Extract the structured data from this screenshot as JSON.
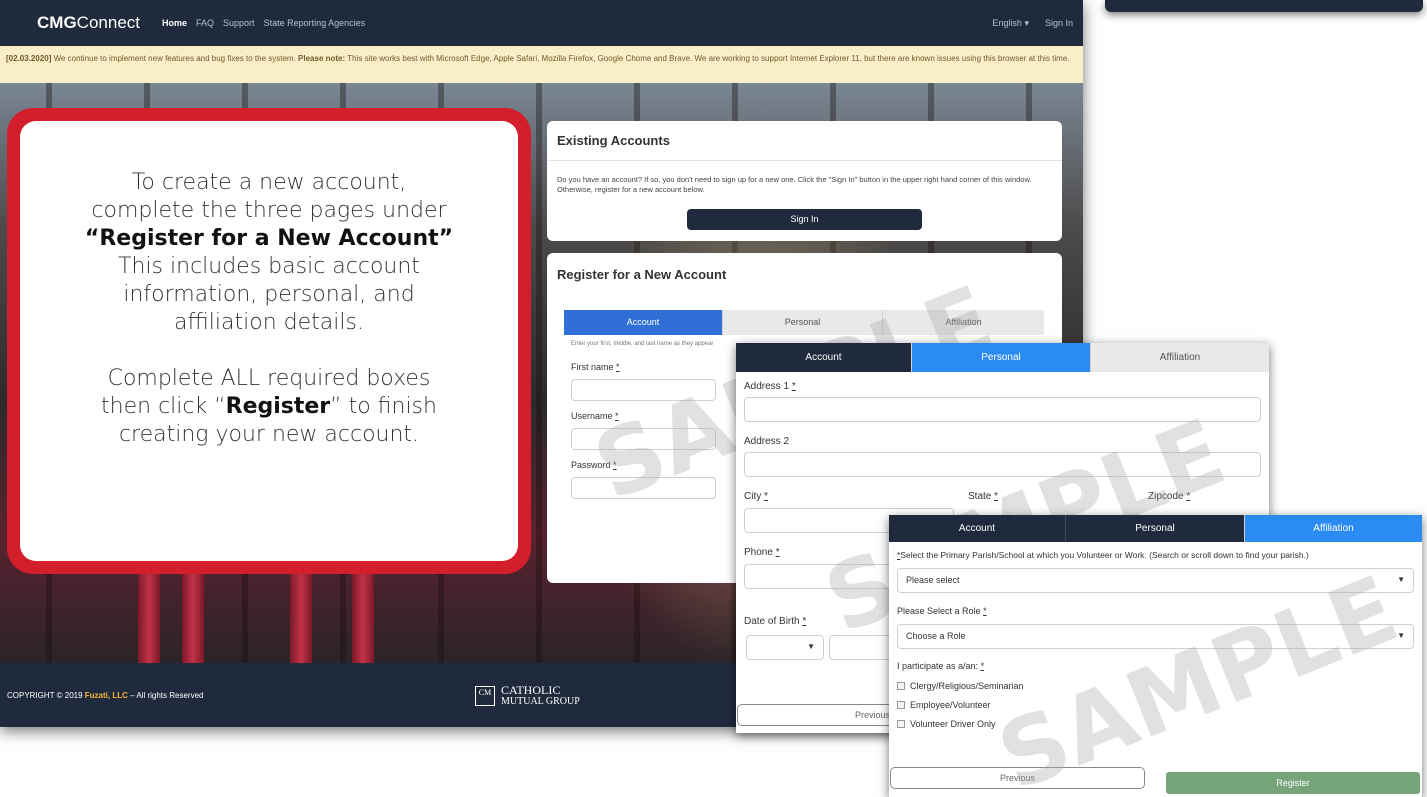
{
  "navbar": {
    "brand_bold": "CMG",
    "brand_rest": "Connect",
    "links": [
      "Home",
      "FAQ",
      "Support",
      "State Reporting Agencies"
    ],
    "language": "English",
    "sign_in": "Sign In"
  },
  "notice": {
    "date": "[02.03.2020]",
    "text_a": " We continue to implement new features and bug fixes to the system. ",
    "note_label": "Please note:",
    "text_b": " This site works best with Microsoft Edge, Apple Safari, Mozilla Firefox, Google Chome and Brave. We are working to support Internet Explorer 11, but there are known issues using this browser at this time."
  },
  "callout": {
    "line1": "To create a new account,",
    "line2": "complete the three pages under",
    "line3": "“Register for a New Account”",
    "line4": "This includes basic account",
    "line5": "information, personal, and",
    "line6": "affiliation details.",
    "line7": "Complete ALL required boxes",
    "line8a": "then click “",
    "line8b": "Register",
    "line8c": "” to finish",
    "line9": "creating your new account."
  },
  "existing": {
    "title": "Existing Accounts",
    "body": "Do you have an account? If so, you don't need to sign up for a new one. Click the \"Sign In\" button in the upper right hand corner of this window. Otherwise, register for a new account below.",
    "button": "Sign In"
  },
  "register": {
    "title": "Register for a New Account",
    "tabs": [
      "Account",
      "Personal",
      "Affiliation"
    ],
    "hint": "Enter your first, middle, and last name as they appear",
    "first_name": "First name",
    "username": "Username",
    "password": "Password",
    "req": "*"
  },
  "personal": {
    "tabs": [
      "Account",
      "Personal",
      "Affiliation"
    ],
    "address1": "Address 1",
    "address2": "Address 2",
    "city": "City",
    "state": "State",
    "zipcode": "Zipcode",
    "phone": "Phone",
    "dob": "Date of Birth",
    "previous": "Previous",
    "req": "*"
  },
  "affiliation": {
    "tabs": [
      "Account",
      "Personal",
      "Affiliation"
    ],
    "parish_label": "Select the Primary Parish/School at which you Volunteer or Work. (Search or scroll down to find your parish.)",
    "parish_value": "Please select",
    "role_label": "Please Select a Role",
    "role_value": "Choose a Role",
    "participate_label": "I participate as a/an:",
    "options": [
      "Clergy/Religious/Seminarian",
      "Employee/Volunteer",
      "Volunteer Driver Only"
    ],
    "previous": "Previous",
    "register": "Register",
    "req": "*"
  },
  "footer": {
    "copyright_a": "COPYRIGHT © 2019 ",
    "company": "Fuzati, LLC",
    "copyright_b": " – All rights Reserved",
    "logo_mark": "CM",
    "logo_line1": "CATHOLIC",
    "logo_line2": "MUTUAL GROUP"
  },
  "watermark": "SAMPLE",
  "colors": {
    "navy": "#1f2b3c",
    "callout_red": "#d31f2c",
    "tab_blue": "#2f6fd6",
    "tab_sky": "#2a8bf2",
    "register_green": "#77a57a",
    "notice_bg": "#faeec9",
    "fuzati_orange": "#f7b733"
  }
}
